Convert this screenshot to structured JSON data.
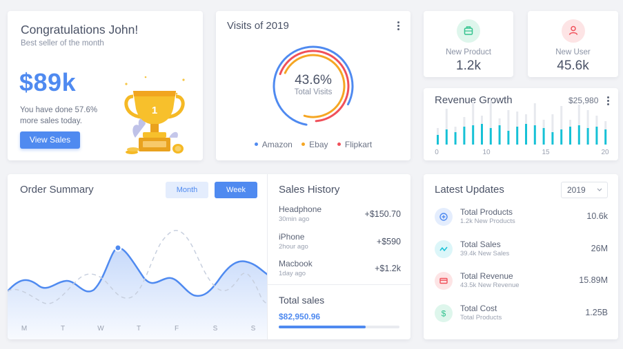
{
  "congrats": {
    "title": "Congratulations John!",
    "subtitle": "Best seller of the month",
    "amount": "$89k",
    "message": "You have done 57.6% more sales today.",
    "button_label": "View Sales"
  },
  "visits": {
    "title": "Visits of 2019",
    "percent": "43.6%",
    "percent_label": "Total Visits",
    "legend": [
      {
        "label": "Amazon",
        "color": "#4f8af0"
      },
      {
        "label": "Ebay",
        "color": "#f5a623"
      },
      {
        "label": "Flipkart",
        "color": "#f0505a"
      }
    ]
  },
  "new_product": {
    "label": "New Product",
    "value": "1.2k",
    "icon": "briefcase-icon",
    "color": "#34c38f"
  },
  "new_user": {
    "label": "New User",
    "value": "45.6k",
    "icon": "user-icon",
    "color": "#f0505a"
  },
  "revenue": {
    "title": "Revenue Growth",
    "amount": "$25,980",
    "tick_labels": [
      "0",
      "10",
      "15",
      "20"
    ],
    "bar_color": "#16c1d6",
    "bg_bar_color": "#e7e9ee"
  },
  "order_summary": {
    "title": "Order Summary",
    "tab_month": "Month",
    "tab_week": "Week",
    "days": [
      "M",
      "T",
      "W",
      "T",
      "F",
      "S",
      "S"
    ]
  },
  "sales_history": {
    "title": "Sales History",
    "items": [
      {
        "name": "Headphone",
        "time": "30min ago",
        "value": "+$150.70"
      },
      {
        "name": "iPhone",
        "time": "2hour ago",
        "value": "+$590"
      },
      {
        "name": "Macbook",
        "time": "1day ago",
        "value": "+$1.2k"
      }
    ],
    "total_label": "Total sales",
    "total_value": "$82,950.96",
    "total_progress": 0.72
  },
  "latest_updates": {
    "title": "Latest Updates",
    "year": "2019",
    "items": [
      {
        "name": "Total Products",
        "sub": "1.2k New Products",
        "value": "10.6k",
        "icon": "plus-circle-icon",
        "color": "#4f8af0",
        "bg": "#e4edfd"
      },
      {
        "name": "Total Sales",
        "sub": "39.4k New Sales",
        "value": "26M",
        "icon": "trend-icon",
        "color": "#16c1d6",
        "bg": "#dcf6f9"
      },
      {
        "name": "Total Revenue",
        "sub": "43.5k New Revenue",
        "value": "15.89M",
        "icon": "card-icon",
        "color": "#f0505a",
        "bg": "#fde4e5"
      },
      {
        "name": "Total Cost",
        "sub": "Total Products",
        "value": "1.25B",
        "icon": "dollar-icon",
        "color": "#34c38f",
        "bg": "#def6ec"
      }
    ]
  }
}
